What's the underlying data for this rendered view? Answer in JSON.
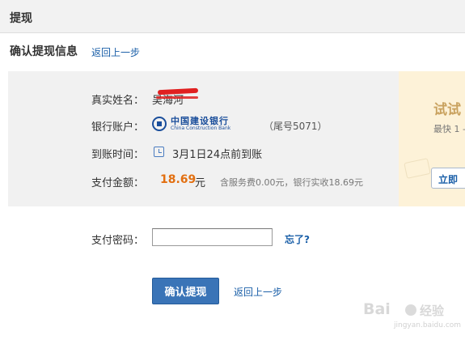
{
  "header": {
    "title": "提现"
  },
  "confirm_section": {
    "heading": "确认提现信息",
    "back_link": "返回上一步"
  },
  "details": {
    "name_label": "真实姓名：",
    "name_value": "吴海河",
    "bank_label": "银行账户：",
    "bank_logo_cn": "中国建设银行",
    "bank_logo_en": "China Construction Bank",
    "card_tail": "（尾号5071）",
    "arrival_label": "到账时间：",
    "arrival_value": "3月1日24点前到账",
    "amount_label": "支付金额：",
    "amount_value": "18.69",
    "amount_unit": "元",
    "amount_note": "含服务费0.00元，银行实收18.69元"
  },
  "promo": {
    "title": "试试",
    "subtitle": "最快 1 -",
    "button_label": "立即"
  },
  "password": {
    "label": "支付密码：",
    "value": "",
    "forgot_link": "忘了?"
  },
  "actions": {
    "confirm_label": "确认提现",
    "back_link": "返回上一步"
  },
  "watermark": {
    "brand": "Bai",
    "suffix": "经验",
    "url": "jingyan.baidu.com"
  },
  "colors": {
    "accent_link": "#1a5fa8",
    "amount": "#e26f10",
    "button": "#3a74b7",
    "promo_bg": "#fdf2d8",
    "panel_bg": "#f1f1f1"
  }
}
